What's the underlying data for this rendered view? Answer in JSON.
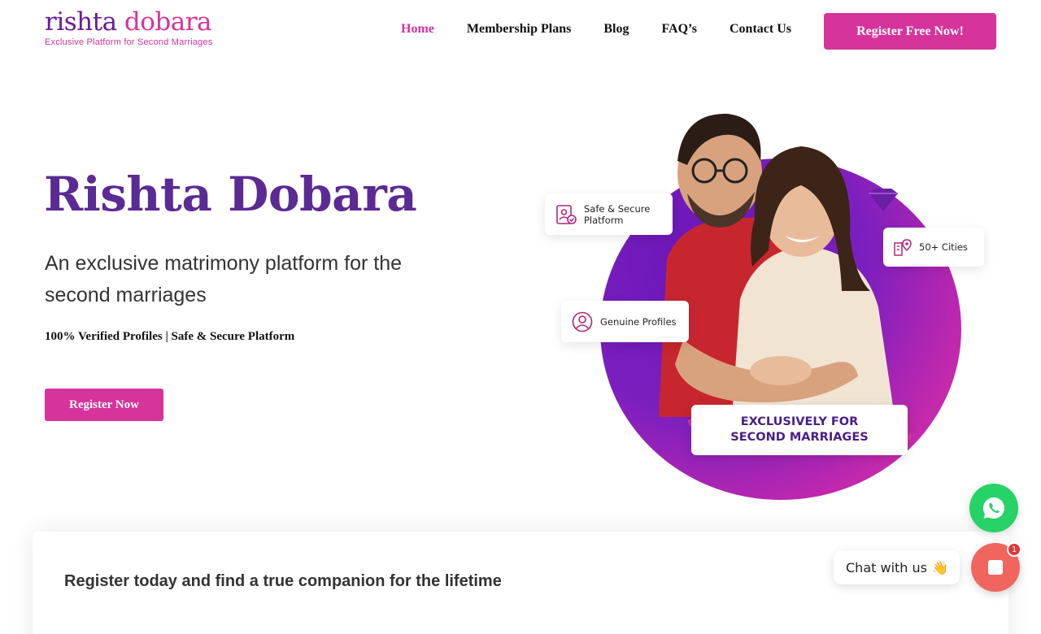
{
  "brand": {
    "logo_word_part1": "rishta ",
    "logo_word_part2": "dobara",
    "logo_tagline": "Exclusive Platform for Second Marriages"
  },
  "nav": {
    "items": [
      {
        "label": "Home",
        "active": true
      },
      {
        "label": "Membership Plans",
        "active": false
      },
      {
        "label": "Blog",
        "active": false
      },
      {
        "label": "FAQ’s",
        "active": false
      },
      {
        "label": "Contact Us",
        "active": false
      }
    ],
    "cta_label": "Register Free Now!"
  },
  "hero": {
    "title": "Rishta Dobara",
    "subtitle": "An exclusive matrimony platform for the second marriages",
    "features": "100% Verified Profiles | Safe & Secure Platform",
    "cta_label": "Register Now",
    "badges": {
      "safe": "Safe & Secure Platform",
      "genuine": "Genuine Profiles",
      "cities": "50+ Cities"
    },
    "exclusive_line1": "EXCLUSIVELY FOR",
    "exclusive_line2": "SECOND MARRIAGES"
  },
  "register_panel": {
    "heading": "Register today and find a true companion for the lifetime"
  },
  "chat": {
    "bubble_text": "Chat with us",
    "bubble_emoji": "👋",
    "unread_count": "1"
  },
  "colors": {
    "brand_pink": "#d6339b",
    "brand_purple": "#5b2a94",
    "whatsapp_green": "#25d366",
    "chat_coral": "#f0665f"
  }
}
